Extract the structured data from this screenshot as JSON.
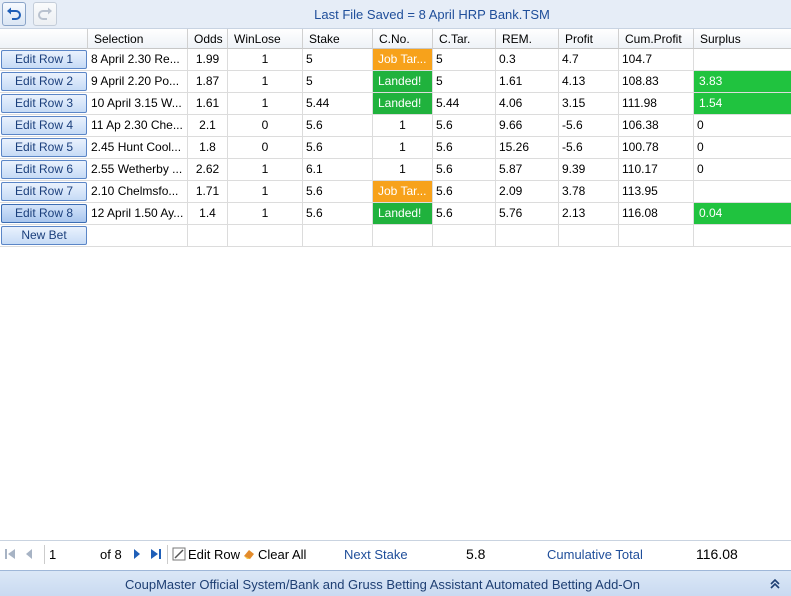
{
  "toolbar": {
    "undo_icon": "undo-icon",
    "redo_icon": "redo-icon",
    "title": "Last File Saved = 8 April HRP Bank.TSM"
  },
  "columns": [
    "Selection",
    "Odds",
    "WinLose",
    "Stake",
    "C.No.",
    "C.Tar.",
    "REM.",
    "Profit",
    "Cum.Profit",
    "Surplus"
  ],
  "rows": [
    {
      "btn": "Edit Row 1",
      "selection": "8 April 2.30 Re...",
      "odds": "1.99",
      "winlose": "1",
      "stake": "5",
      "cno": "Job Tar...",
      "ctar": "5",
      "rem": "0.3",
      "profit": "4.7",
      "cum": "104.7",
      "surplus": ""
    },
    {
      "btn": "Edit Row 2",
      "selection": "9 April 2.20 Po...",
      "odds": "1.87",
      "winlose": "1",
      "stake": "5",
      "cno": "Landed!",
      "ctar": "5",
      "rem": "1.61",
      "profit": "4.13",
      "cum": "108.83",
      "surplus": "3.83"
    },
    {
      "btn": "Edit Row 3",
      "selection": "10 April 3.15 W...",
      "odds": "1.61",
      "winlose": "1",
      "stake": "5.44",
      "cno": "Landed!",
      "ctar": "5.44",
      "rem": "4.06",
      "profit": "3.15",
      "cum": "111.98",
      "surplus": "1.54"
    },
    {
      "btn": "Edit Row 4",
      "selection": "11 Ap 2.30 Che...",
      "odds": "2.1",
      "winlose": "0",
      "stake": "5.6",
      "cno": "1",
      "ctar": "5.6",
      "rem": "9.66",
      "profit": "-5.6",
      "cum": "106.38",
      "surplus": "0"
    },
    {
      "btn": "Edit Row 5",
      "selection": "2.45 Hunt Cool...",
      "odds": "1.8",
      "winlose": "0",
      "stake": "5.6",
      "cno": "1",
      "ctar": "5.6",
      "rem": "15.26",
      "profit": "-5.6",
      "cum": "100.78",
      "surplus": "0"
    },
    {
      "btn": "Edit Row 6",
      "selection": "2.55 Wetherby ...",
      "odds": "2.62",
      "winlose": "1",
      "stake": "6.1",
      "cno": "1",
      "ctar": "5.6",
      "rem": "5.87",
      "profit": "9.39",
      "cum": "110.17",
      "surplus": "0"
    },
    {
      "btn": "Edit Row 7",
      "selection": "2.10 Chelmsfo...",
      "odds": "1.71",
      "winlose": "1",
      "stake": "5.6",
      "cno": "Job Tar...",
      "ctar": "5.6",
      "rem": "2.09",
      "profit": "3.78",
      "cum": "113.95",
      "surplus": ""
    },
    {
      "btn": "Edit Row 8",
      "selection": "12 April 1.50 Ay...",
      "odds": "1.4",
      "winlose": "1",
      "stake": "5.6",
      "cno": "Landed!",
      "ctar": "5.6",
      "rem": "5.76",
      "profit": "2.13",
      "cum": "116.08",
      "surplus": "0.04"
    }
  ],
  "new_bet_label": "New Bet",
  "colors": {
    "job_target": "#f7a21b",
    "landed": "#20b23d",
    "surplus_positive": "#20c33f",
    "accent": "#1f4e9a"
  },
  "navigator": {
    "current_page": "1",
    "page_of": "of 8",
    "edit_row_label": "Edit Row",
    "clear_all_label": "Clear All",
    "next_stake_label": "Next Stake",
    "next_stake_value": "5.8",
    "cumulative_total_label": "Cumulative Total",
    "cumulative_total_value": "116.08"
  },
  "status_bar": {
    "text": "CoupMaster Official System/Bank and Gruss Betting Assistant Automated Betting Add-On",
    "collapse_icon": "double-chevron-up-icon"
  }
}
